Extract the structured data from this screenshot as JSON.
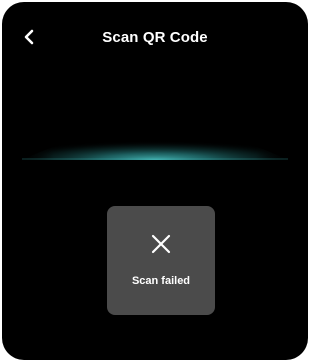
{
  "header": {
    "title": "Scan QR Code",
    "back_icon": "chevron-left-icon"
  },
  "scanner": {
    "glow_color": "#3fb8b8",
    "background_color": "#000000"
  },
  "toast": {
    "icon": "close-icon",
    "message": "Scan failed",
    "background_color": "#4b4b4b"
  }
}
